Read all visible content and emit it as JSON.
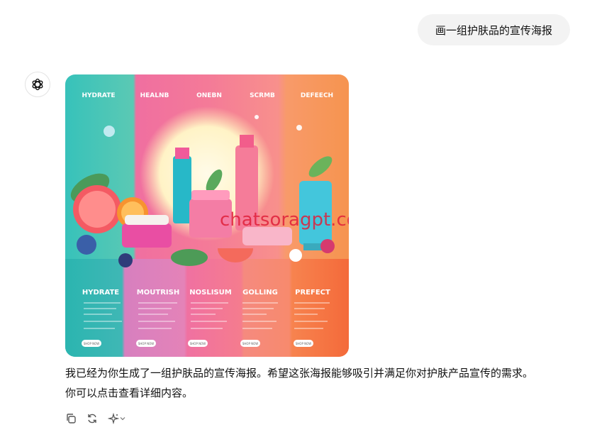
{
  "user_message": "画一组护肤品的宣传海报",
  "assistant": {
    "avatar_icon": "openai-logo-icon",
    "reply_line1": "我已经为你生成了一组护肤品的宣传海报。希望这张海报能够吸引并满足你对护肤产品宣传的需求。",
    "reply_line2": "你可以点击查看详细内容。"
  },
  "poster": {
    "top_labels": [
      "HYDRATE",
      "HEALNB",
      "ONEBN",
      "SCRMB",
      "DEFEECH"
    ],
    "bottom_labels": [
      "HYDRATE",
      "MOUTRISH",
      "NOSLISUM",
      "GOLLING",
      "PREFECT"
    ],
    "buttons": [
      "SHOP NOW",
      "SHOP NOW",
      "SHOP NOW",
      "SHOP NOW",
      "SHOP NOW"
    ],
    "column_colors": [
      "#3fc0b8",
      "#f06b9d",
      "#f3788c",
      "#f89a88",
      "#f79a5f"
    ],
    "watermark": "chatsoragpt.com"
  },
  "actions": {
    "copy_icon": "copy-icon",
    "regenerate_icon": "regenerate-icon",
    "model_icon": "sparkle-icon",
    "dropdown_icon": "chevron-down-icon"
  }
}
